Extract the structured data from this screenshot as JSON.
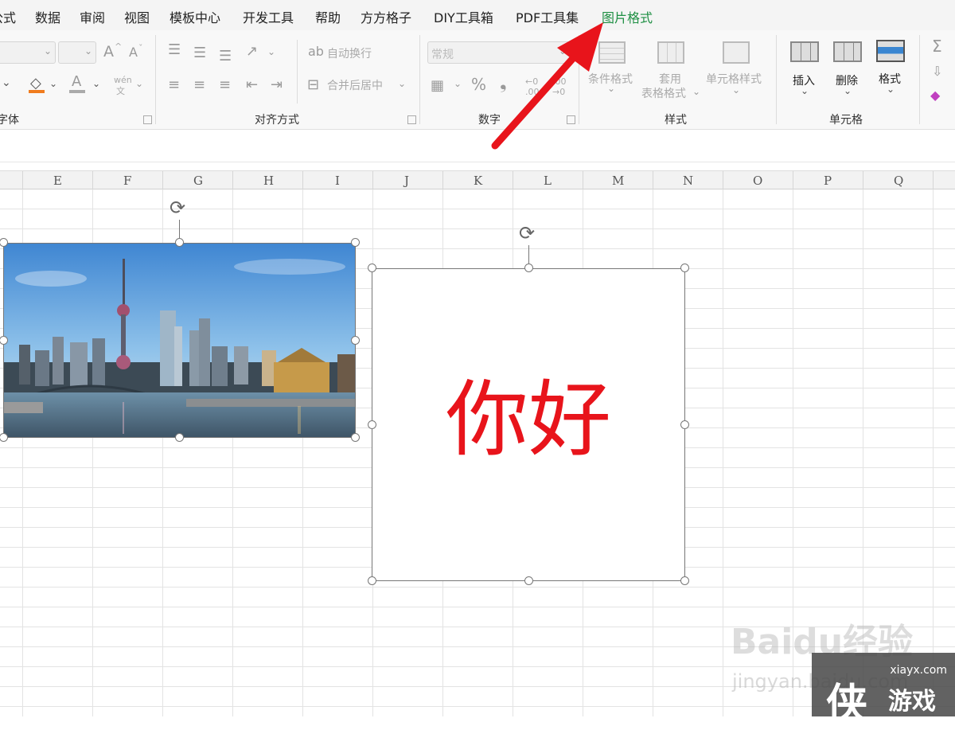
{
  "menu": {
    "items": [
      "公式",
      "数据",
      "审阅",
      "视图",
      "模板中心",
      "开发工具",
      "帮助",
      "方方格子",
      "DIY工具箱",
      "PDF工具集",
      "图片格式"
    ],
    "active": "图片格式"
  },
  "ribbon": {
    "font_group": "字体",
    "align_group": "对齐方式",
    "wrap_label": "自动换行",
    "merge_label": "合并后居中",
    "number_group": "数字",
    "number_format": "常规",
    "percent": "%",
    "comma": "❟",
    "style_group": "样式",
    "cond_format": "条件格式",
    "table_format_1": "套用",
    "table_format_2": "表格格式",
    "cell_style": "单元格样式",
    "cells_group": "单元格",
    "insert": "插入",
    "delete": "删除",
    "format": "格式",
    "font_grow": "A",
    "font_shrink": "A",
    "phonetic": "wén",
    "phonetic_sub": "文",
    "sum": "Σ"
  },
  "columns": [
    "E",
    "F",
    "G",
    "H",
    "I",
    "J",
    "K",
    "L",
    "M",
    "N",
    "O",
    "P",
    "Q"
  ],
  "textbox": {
    "text": "你好",
    "color": "#e8141b"
  },
  "watermark": {
    "main": "Baidu经验",
    "sub": "jingyan.baidu.com"
  },
  "badge": {
    "site": "xiayx.com",
    "big": "侠",
    "name": "游戏"
  },
  "arrow_color": "#e8141b"
}
